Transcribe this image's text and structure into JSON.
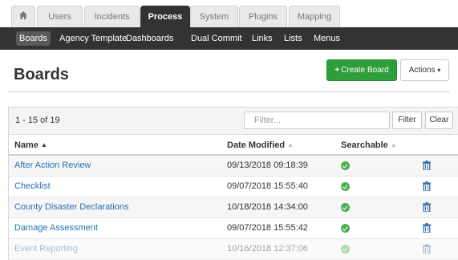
{
  "tabs": [
    {
      "label": "",
      "icon": "home-icon"
    },
    {
      "label": "Users"
    },
    {
      "label": "Incidents"
    },
    {
      "label": "Process",
      "active": true
    },
    {
      "label": "System"
    },
    {
      "label": "Plugins"
    },
    {
      "label": "Mapping"
    }
  ],
  "subnav": [
    {
      "label": "Boards",
      "active": true
    },
    {
      "label": "Agency Template"
    },
    {
      "label": "Dashboards"
    },
    {
      "label": "Dual Commit"
    },
    {
      "label": "Links"
    },
    {
      "label": "Lists"
    },
    {
      "label": "Menus"
    }
  ],
  "page": {
    "title": "Boards",
    "create_label": "Create Board",
    "actions_label": "Actions",
    "actions_caret": "▾"
  },
  "toolbar": {
    "count": "1 - 15 of 19",
    "filter_placeholder": "Filter...",
    "filter_label": "Filter",
    "clear_label": "Clear"
  },
  "columns": {
    "name": "Name",
    "date": "Date Modified",
    "searchable": "Searchable"
  },
  "rows": [
    {
      "name": "After Action Review",
      "date": "09/13/2018 09:18:39",
      "searchable": true
    },
    {
      "name": "Checklist",
      "date": "09/07/2018 15:55:40",
      "searchable": true
    },
    {
      "name": "County Disaster Declarations",
      "date": "10/18/2018 14:34:00",
      "searchable": true
    },
    {
      "name": "Damage Assessment",
      "date": "09/07/2018 15:55:42",
      "searchable": true
    },
    {
      "name": "Event Reporting",
      "date": "10/16/2018 12:37:06",
      "searchable": true
    }
  ],
  "colors": {
    "nav_bg": "#333333",
    "create_green": "#2e9e3a",
    "link_blue": "#2a6fb3",
    "check_green": "#4caf50"
  }
}
